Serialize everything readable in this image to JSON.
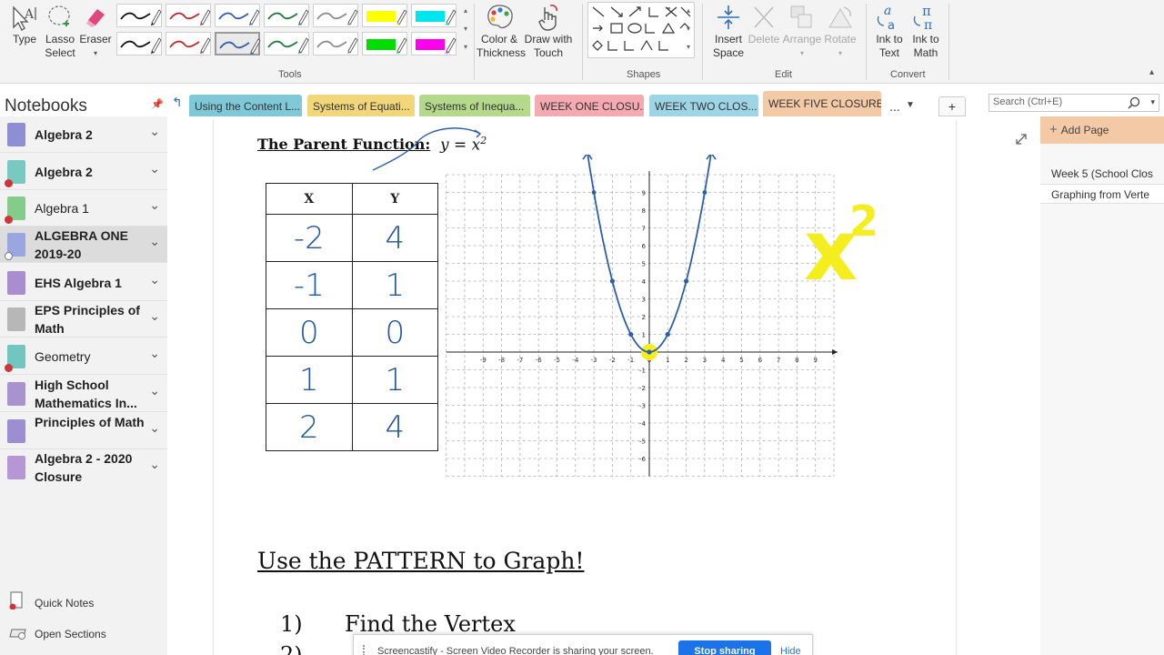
{
  "ribbon": {
    "type_label": "Type",
    "lasso_label": "Lasso Select",
    "eraser_label": "Eraser",
    "tools_group": "Tools",
    "color_label": "Color & Thickness",
    "draw_touch_label": "Draw with Touch",
    "shapes_group": "Shapes",
    "insert_space_label": "Insert Space",
    "delete_label": "Delete",
    "arrange_label": "Arrange",
    "rotate_label": "Rotate",
    "edit_group": "Edit",
    "ink_text_label": "Ink to Text",
    "ink_math_label": "Ink to Math",
    "convert_group": "Convert",
    "pens": [
      {
        "color": "#111111",
        "highlight": false
      },
      {
        "color": "#c0282c",
        "highlight": false
      },
      {
        "color": "#2a5fae",
        "highlight": false
      },
      {
        "color": "#1f7a3a",
        "highlight": false
      },
      {
        "color": "#8c8c8c",
        "highlight": false
      },
      {
        "color": "#ffff00",
        "highlight": true
      },
      {
        "color": "#00e5ee",
        "highlight": true
      },
      {
        "color": "#111111",
        "highlight": false
      },
      {
        "color": "#c0282c",
        "highlight": false
      },
      {
        "color": "#2a5fae",
        "highlight": false,
        "selected": true
      },
      {
        "color": "#1f7a3a",
        "highlight": false
      },
      {
        "color": "#8c8c8c",
        "highlight": false
      },
      {
        "color": "#00dd00",
        "highlight": true
      },
      {
        "color": "#ff00ee",
        "highlight": true
      }
    ]
  },
  "notebooks_header": "Notebooks",
  "tabs": [
    {
      "label": "Using the Content L...",
      "color": "#7ec8d8"
    },
    {
      "label": "Systems of Equati...",
      "color": "#f2d67a"
    },
    {
      "label": "Systems of Inequa...",
      "color": "#b5d98a"
    },
    {
      "label": "WEEK ONE CLOSU...",
      "color": "#f4aab0"
    },
    {
      "label": "WEEK TWO CLOS...",
      "color": "#9dd4e6"
    },
    {
      "label": "WEEK FIVE CLOSURE",
      "color": "#f3c9a6"
    },
    {
      "label": "...",
      "color": "#f2f2f2"
    },
    {
      "label": "+",
      "color": "#f2f2f2"
    }
  ],
  "search_placeholder": "Search (Ctrl+E)",
  "notebooks": [
    {
      "label": "Algebra 2",
      "bold": true,
      "color": "#8e8ed4",
      "status": ""
    },
    {
      "label": "Algebra 2",
      "bold": true,
      "color": "#79c9c3",
      "status": "error"
    },
    {
      "label": "Algebra 1",
      "bold": false,
      "color": "#84cc8a",
      "status": "error"
    },
    {
      "label": "ALGEBRA ONE 2019-20",
      "bold": true,
      "color": "#9aa6e0",
      "status": "sync"
    },
    {
      "label": "EHS Algebra 1",
      "bold": true,
      "color": "#a88ecf",
      "status": ""
    },
    {
      "label": "EPS Principles of Math",
      "bold": true,
      "color": "#b7b7b7",
      "status": ""
    },
    {
      "label": "Geometry",
      "bold": false,
      "color": "#72c6c0",
      "status": "error"
    },
    {
      "label": "High School Mathematics In...",
      "bold": true,
      "color": "#a993cf",
      "status": ""
    },
    {
      "label": "Principles of Math",
      "bold": true,
      "color": "#9c8ed1",
      "status": ""
    },
    {
      "label": "Algebra 2 - 2020 Closure",
      "bold": true,
      "color": "#b597d6",
      "status": ""
    }
  ],
  "quick_notes": "Quick Notes",
  "open_sections": "Open Sections",
  "page": {
    "heading": "The Parent Function:",
    "equation": "y = x",
    "exponent": "2",
    "table_headers": [
      "X",
      "Y"
    ],
    "table_rows": [
      [
        "-2",
        "4"
      ],
      [
        "-1",
        "1"
      ],
      [
        "0",
        "0"
      ],
      [
        "1",
        "1"
      ],
      [
        "2",
        "4"
      ]
    ],
    "x_ticks": [
      "-9",
      "-8",
      "-7",
      "-6",
      "-5",
      "-4",
      "-3",
      "-2",
      "-1",
      "0",
      "1",
      "2",
      "3",
      "4",
      "5",
      "6",
      "7",
      "8",
      "9"
    ],
    "y_ticks": [
      "9",
      "8",
      "7",
      "6",
      "5",
      "4",
      "3",
      "2",
      "1",
      "-1",
      "-2",
      "-3",
      "-4",
      "-5",
      "-6"
    ],
    "parabola_points": [
      [
        -2,
        4
      ],
      [
        -1,
        1
      ],
      [
        0,
        0
      ],
      [
        1,
        1
      ],
      [
        2,
        4
      ]
    ],
    "handwritten_big": "x",
    "handwritten_exp": "2",
    "pattern_heading": "Use the PATTERN to Graph!",
    "step1_num": "1)",
    "step1_text": "Find the Vertex",
    "step2_num": "2)"
  },
  "add_page": "Add Page",
  "pages": [
    {
      "label": "Week 5 (School Clos",
      "selected": false
    },
    {
      "label": "Graphing from Verte",
      "selected": true
    }
  ],
  "share_bar": {
    "message": "Screencastify - Screen Video Recorder is sharing your screen.",
    "stop": "Stop sharing",
    "hide": "Hide"
  }
}
